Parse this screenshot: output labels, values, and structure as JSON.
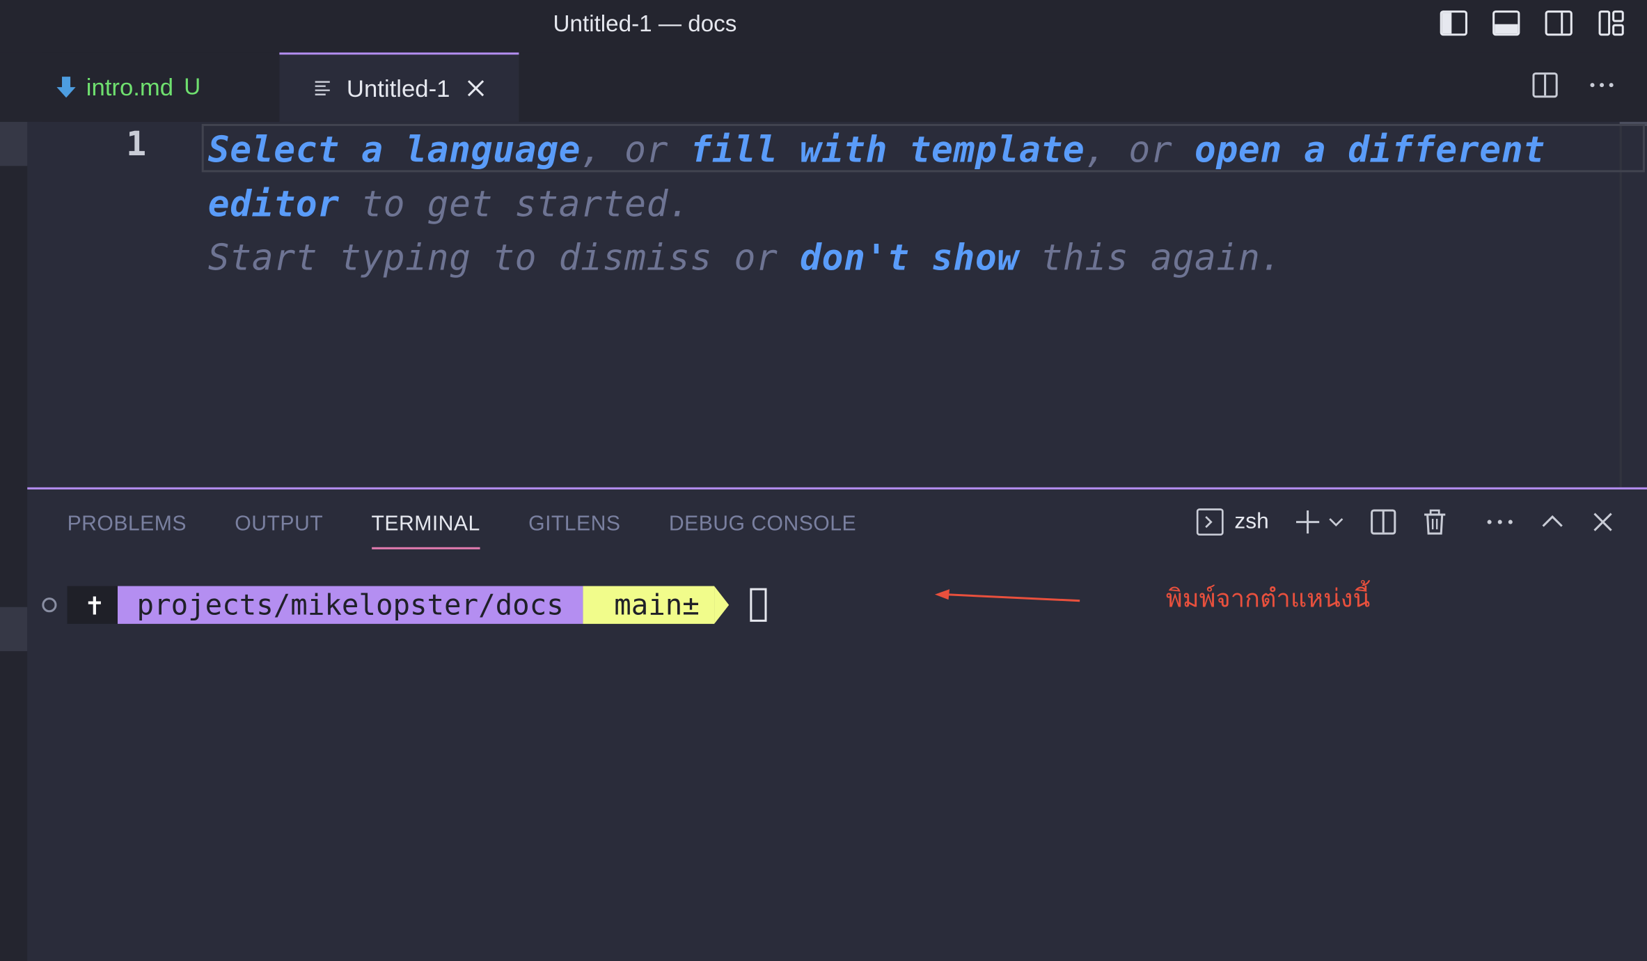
{
  "window": {
    "title": "Untitled-1 — docs"
  },
  "tabs": [
    {
      "label": "intro.md",
      "badge": "U",
      "icon": "markdown-down-arrow-icon"
    },
    {
      "label": "Untitled-1",
      "icon": "text-file-icon"
    }
  ],
  "editor": {
    "line_number": "1",
    "hint_row1": [
      "Select a language",
      ", or ",
      "fill with template",
      ", or ",
      "open a different"
    ],
    "hint_row2": [
      "editor",
      " to get started."
    ],
    "hint_row3": [
      "Start typing to dismiss or ",
      "don't show",
      " this again."
    ]
  },
  "panel": {
    "tabs": [
      "PROBLEMS",
      "OUTPUT",
      "TERMINAL",
      "GITLENS",
      "DEBUG CONSOLE"
    ],
    "active_tab": "TERMINAL",
    "terminal_label": "zsh"
  },
  "terminal": {
    "symbol": "✝",
    "path": "projects/mikelopster/docs",
    "branch_icon": "",
    "branch": "main±"
  },
  "annotation": {
    "text": "พิมพ์จากตำแหน่งนี้"
  },
  "colors": {
    "accent_purple": "#b48ef1",
    "branch_yellow": "#f1fc8b",
    "link_blue": "#5a9cf9",
    "hint_gray": "#6e7493",
    "annotation_red": "#e8503d",
    "untracked_green": "#6fe06f"
  }
}
